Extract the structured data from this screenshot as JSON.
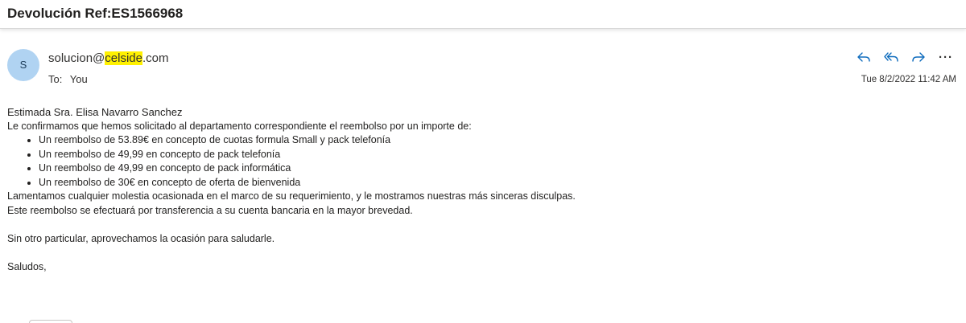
{
  "message": {
    "subject": "Devolución Ref:ES1566968",
    "sender": {
      "avatar_initial": "S",
      "email_prefix": "solucion@",
      "email_highlight": "celside",
      "email_suffix": ".com"
    },
    "recipients": {
      "label": "To:",
      "value": "You"
    },
    "timestamp": "Tue 8/2/2022 11:42 AM",
    "actions": {
      "reply_icon": "reply-icon",
      "reply_all_icon": "reply-all-icon",
      "forward_icon": "forward-icon",
      "more_label": "···"
    },
    "body": {
      "greeting": "Estimada Sra. Elisa Navarro Sanchez",
      "intro": "Le confirmamos que hemos solicitado al departamento correspondiente el reembolso por un importe de:",
      "items": [
        "Un reembolso de 53.89€ en concepto de cuotas formula Small y pack telefonía",
        "Un reembolso de 49,99 en concepto de pack telefonía",
        "Un reembolso de 49,99 en concepto de pack informática",
        "Un reembolso de 30€ en concepto de oferta de bienvenida"
      ],
      "apology": "Lamentamos cualquier molestia ocasionada en el marco de su requerimiento, y le mostramos nuestras más sinceras disculpas.",
      "transfer_note": "Este reembolso se efectuará por transferencia a su cuenta bancaria en la mayor brevedad.",
      "closing": "Sin otro particular, aprovechamos la ocasión para saludarle.",
      "signoff": "Saludos,"
    }
  }
}
